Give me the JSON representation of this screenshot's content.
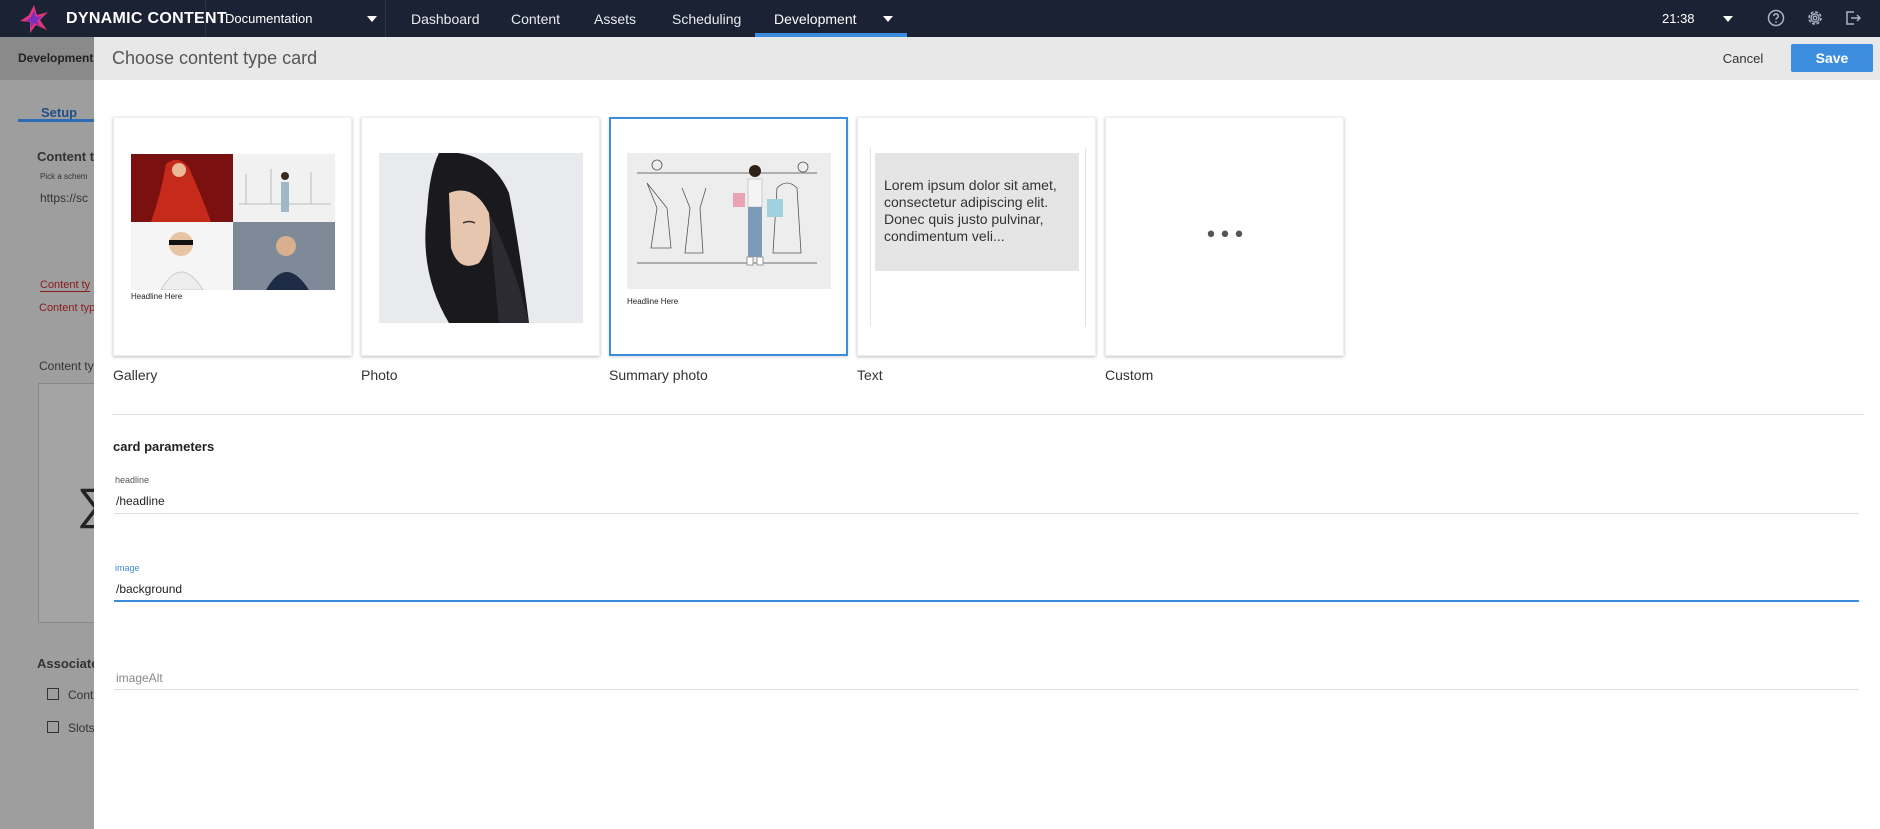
{
  "topbar": {
    "brand": "DYNAMIC CONTENT",
    "hub": "Documentation",
    "nav": [
      "Dashboard",
      "Content",
      "Assets",
      "Scheduling",
      "Development"
    ],
    "active_nav": "Development",
    "time": "21:38",
    "icons": [
      "help-icon",
      "gear-icon",
      "logout-icon"
    ]
  },
  "background_page": {
    "subnav": "Development",
    "tab": "Setup",
    "texts": {
      "content_type": "Content ty",
      "schema_hint": "Pick a schem",
      "schema_url": "https://sc",
      "content_type_error": "Content ty",
      "content_type_error2": "Content typ",
      "content_type_label": "Content ty",
      "associated": "Associate",
      "check1": "Cont",
      "check2": "Slots"
    }
  },
  "modal": {
    "title": "Choose content type card",
    "cancel": "Cancel",
    "save": "Save",
    "cards": [
      {
        "label": "Gallery",
        "headline": "Headline Here"
      },
      {
        "label": "Photo"
      },
      {
        "label": "Summary photo",
        "headline": "Headline Here",
        "selected": true
      },
      {
        "label": "Text",
        "lorem": "Lorem ipsum dolor sit amet, consectetur adipiscing elit. Donec quis justo pulvinar, condimentum veli..."
      },
      {
        "label": "Custom",
        "glyph": "•••"
      }
    ],
    "params_title": "card parameters",
    "fields": [
      {
        "label": "headline",
        "value": "/headline"
      },
      {
        "label": "image",
        "value": "/background"
      },
      {
        "label": "",
        "placeholder": "imageAlt",
        "value": ""
      }
    ]
  },
  "colors": {
    "accent": "#3c8dde",
    "topbar": "#1a2233",
    "brand_pink": "#e0357a"
  }
}
